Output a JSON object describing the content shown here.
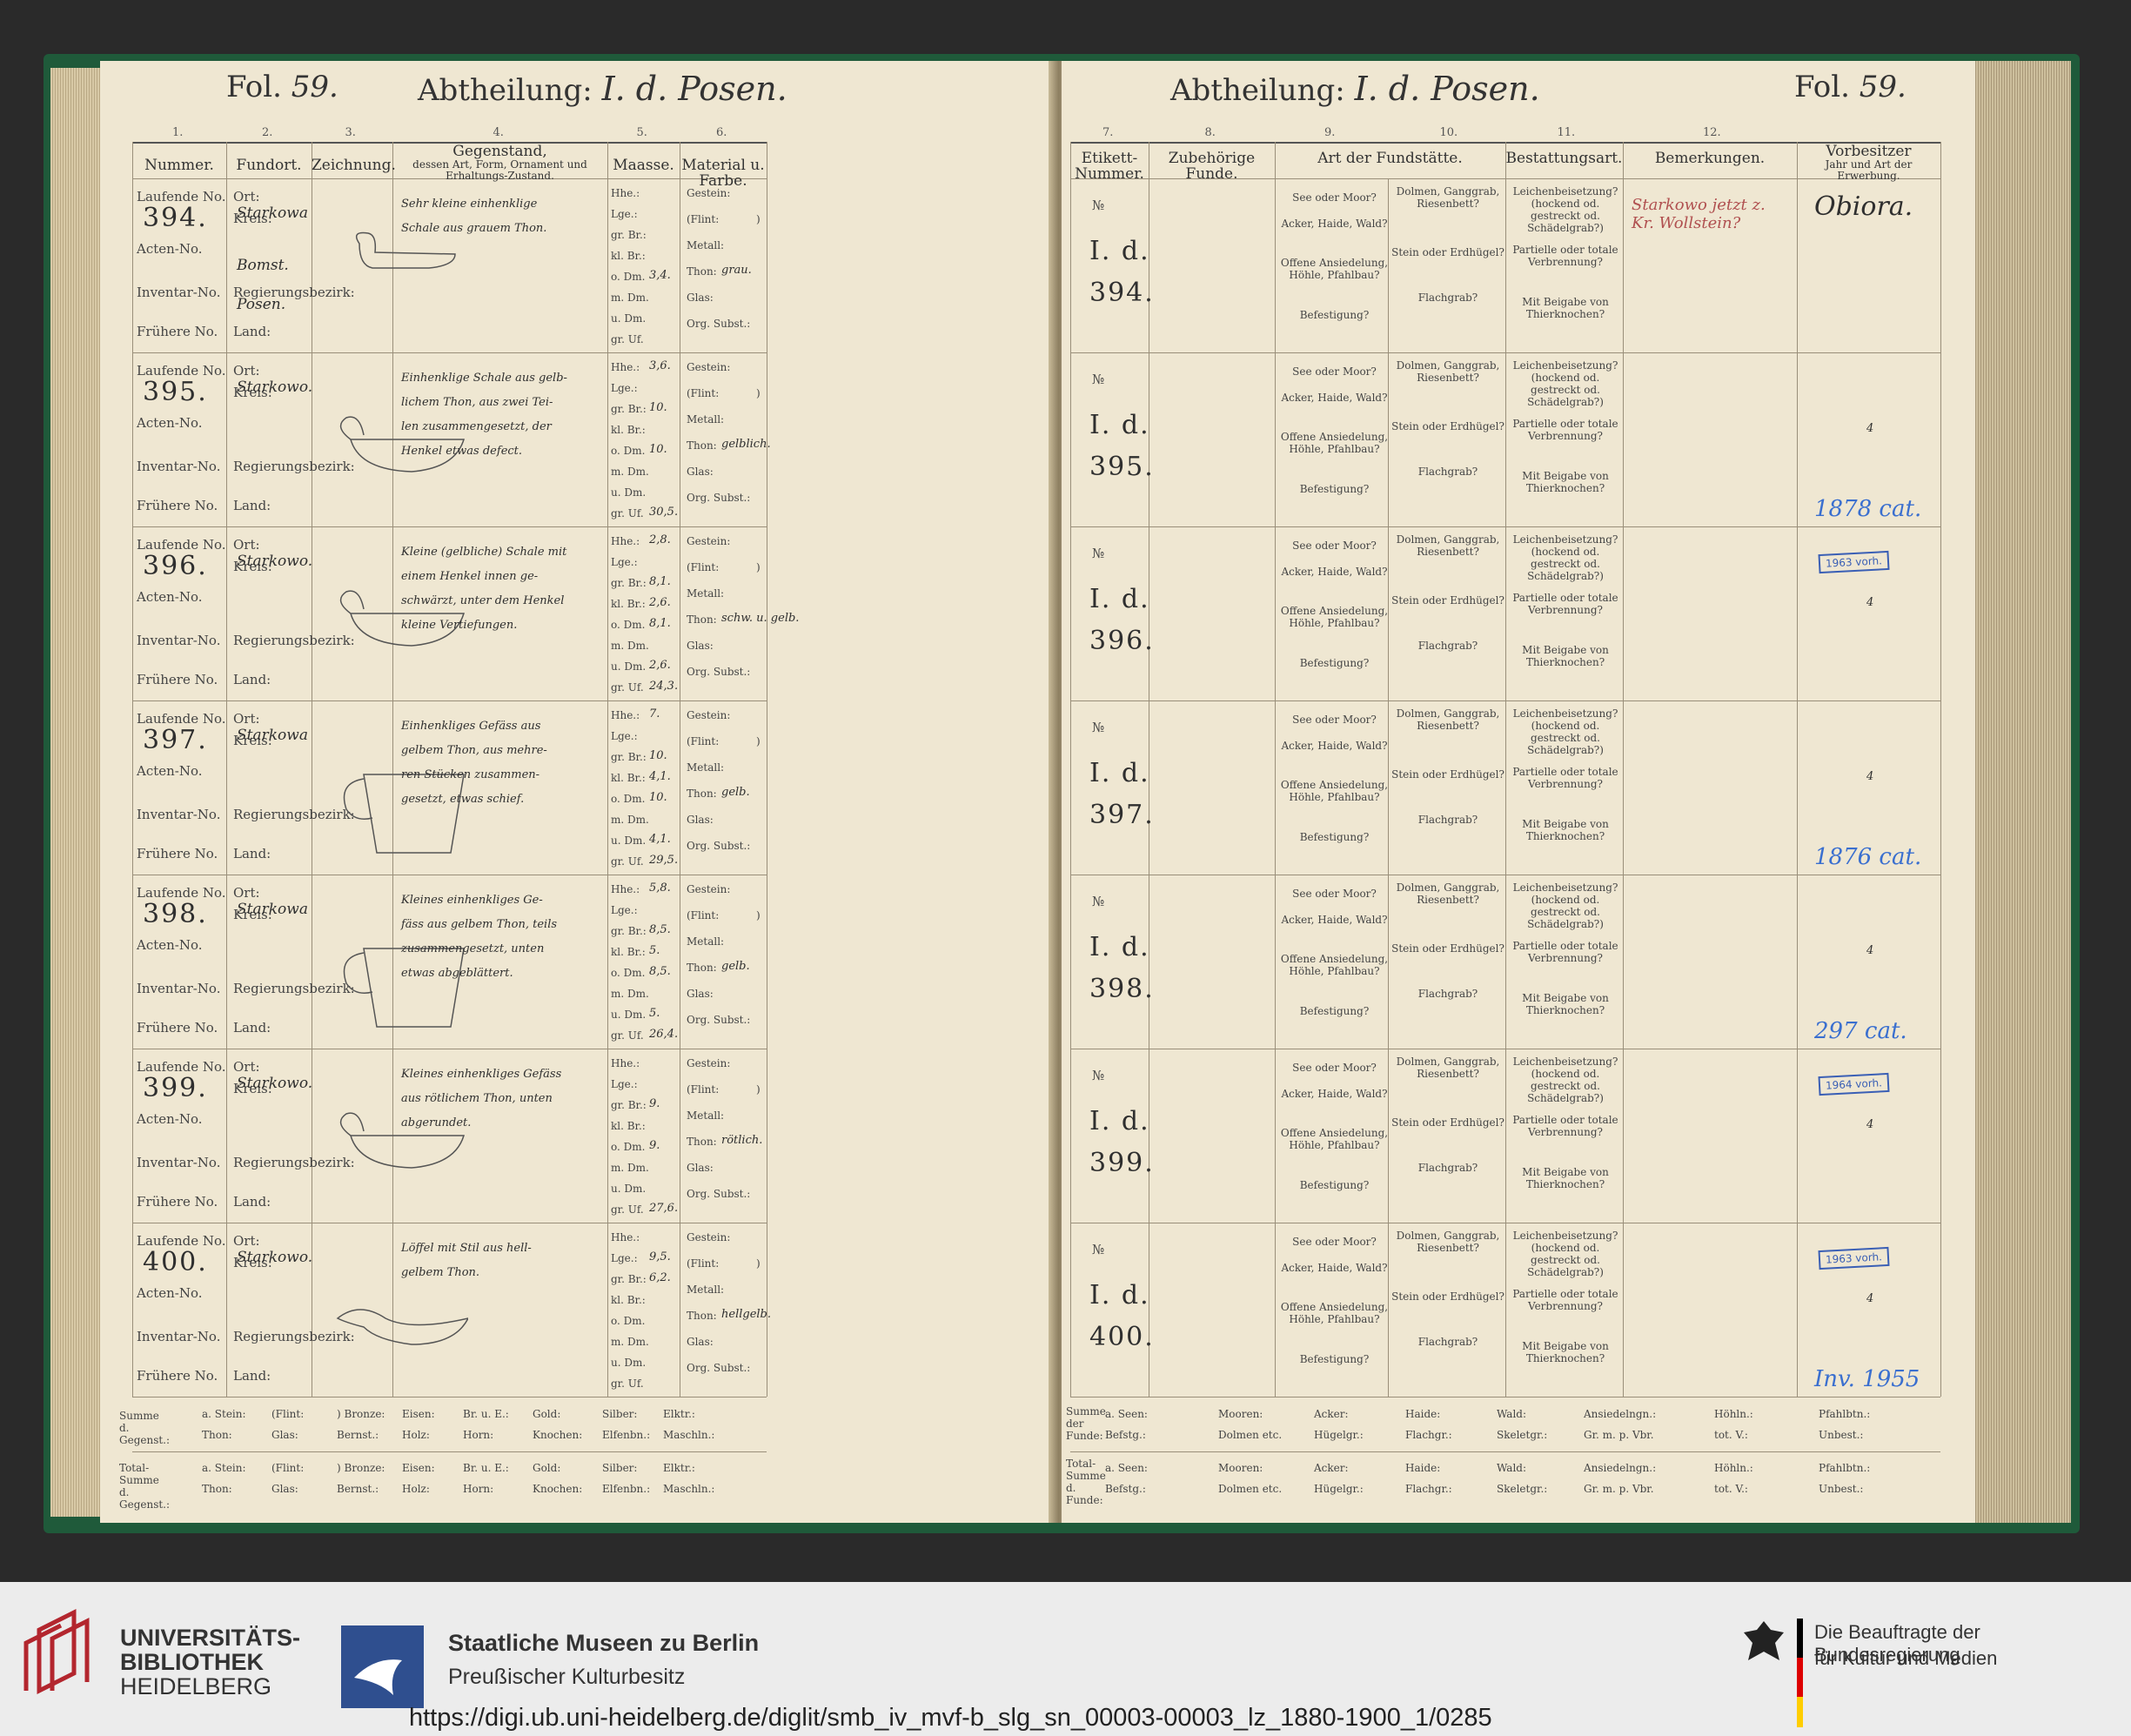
{
  "left": {
    "fol_label": "Fol.",
    "fol_no": "59.",
    "abt_label": "Abtheilung:",
    "abt_value": "I. d. Posen.",
    "colnums": [
      "1.",
      "2.",
      "3.",
      "4.",
      "5.",
      "6."
    ],
    "headers": {
      "nummer": "Nummer.",
      "fundort": "Fundort.",
      "zeichnung": "Zeichnung.",
      "gegenstand": "Gegenstand,",
      "gegenstand_sub": "dessen Art, Form, Ornament und Erhaltungs-Zustand.",
      "maasse": "Maasse.",
      "material": "Material u. Farbe."
    },
    "row_labels": [
      "Laufende No.",
      "Acten-No.",
      "Inventar-No.",
      "Frühere No."
    ],
    "fundort_labels": [
      "Ort:",
      "Kreis:",
      "Regierungsbezirk:",
      "Land:"
    ],
    "maasse_labels": [
      "Hhe.:",
      "Lge.:",
      "gr. Br.:",
      "kl. Br.:",
      "o. Dm.",
      "m. Dm.",
      "u. Dm.",
      "gr. Uf."
    ],
    "material_labels": [
      "Gestein:",
      "(Flint:",
      ")",
      "Metall:",
      "Thon:",
      "Glas:",
      "Org. Subst.:"
    ],
    "rows": [
      {
        "no": "394.",
        "ort": "Starkowa",
        "kreis": "Bomst.",
        "bezirk": "Posen.",
        "desc": [
          "Sehr kleine einhenklige",
          "Schale aus grauem Thon."
        ],
        "measures": [
          "",
          "",
          "",
          "",
          "3,4.",
          "",
          "",
          ""
        ],
        "thon": "grau."
      },
      {
        "no": "395.",
        "ort": "Starkowo.",
        "kreis": "",
        "bezirk": "",
        "desc": [
          "Einhenklige Schale aus gelb-",
          "lichem Thon, aus zwei Tei-",
          "len zusammengesetzt, der",
          "Henkel etwas defect."
        ],
        "measures": [
          "3,6.",
          "",
          "10.",
          "",
          "10.",
          "",
          "",
          "30,5."
        ],
        "thon": "gelblich."
      },
      {
        "no": "396.",
        "ort": "Starkowo.",
        "kreis": "",
        "bezirk": "",
        "desc": [
          "Kleine (gelbliche) Schale mit",
          "einem Henkel innen ge-",
          "schwärzt, unter dem Henkel",
          "kleine Vertiefungen."
        ],
        "measures": [
          "2,8.",
          "",
          "8,1.",
          "2,6.",
          "8,1.",
          "",
          "2,6.",
          "24,3."
        ],
        "thon": "schw. u. gelb."
      },
      {
        "no": "397.",
        "ort": "Starkowa",
        "kreis": "",
        "bezirk": "",
        "desc": [
          "Einhenkliges Gefäss aus",
          "gelbem Thon, aus mehre-",
          "ren Stücken zusammen-",
          "gesetzt, etwas schief."
        ],
        "measures": [
          "7.",
          "",
          "10.",
          "4,1.",
          "10.",
          "",
          "4,1.",
          "29,5."
        ],
        "thon": "gelb."
      },
      {
        "no": "398.",
        "ort": "Starkowa",
        "kreis": "",
        "bezirk": "",
        "desc": [
          "Kleines einhenkliges Ge-",
          "fäss aus gelbem Thon, teils",
          "zusammengesetzt, unten",
          "etwas abgeblättert."
        ],
        "measures": [
          "5,8.",
          "",
          "8,5.",
          "5.",
          "8,5.",
          "",
          "5.",
          "26,4."
        ],
        "thon": "gelb."
      },
      {
        "no": "399.",
        "ort": "Starkowo.",
        "kreis": "",
        "bezirk": "",
        "desc": [
          "Kleines einhenkliges Gefäss",
          "aus rötlichem Thon, unten",
          "abgerundet."
        ],
        "measures": [
          "",
          "",
          "9.",
          "",
          "9.",
          "",
          "",
          "27,6."
        ],
        "thon": "rötlich."
      },
      {
        "no": "400.",
        "ort": "Starkowo.",
        "kreis": "",
        "bezirk": "",
        "desc": [
          "Löffel mit Stil aus hell-",
          "gelbem Thon."
        ],
        "measures": [
          "",
          "9,5.",
          "6,2.",
          "",
          "",
          "",
          "",
          ""
        ],
        "thon": "hellgelb."
      }
    ],
    "sum1_label": "Summe d. Gegenst.:",
    "sum1_row1": [
      "a. Stein:",
      "(Flint:",
      ") Bronze:",
      "Eisen:",
      "Br. u. E.:",
      "Gold:",
      "Silber:",
      "Elktr.:"
    ],
    "sum1_row2": [
      "Thon:",
      "Glas:",
      "Bernst.:",
      "Holz:",
      "Horn:",
      "Knochen:",
      "Elfenbn.:",
      "Maschln.:"
    ],
    "sum2_label": "Total-Summe d. Gegenst.:",
    "sum2_row1": [
      "a. Stein:",
      "(Flint:",
      ") Bronze:",
      "Eisen:",
      "Br. u. E.:",
      "Gold:",
      "Silber:",
      "Elktr.:"
    ],
    "sum2_row2": [
      "Thon:",
      "Glas:",
      "Bernst.:",
      "Holz:",
      "Horn:",
      "Knochen:",
      "Elfenbn.:",
      "Maschln.:"
    ]
  },
  "right": {
    "fol_label": "Fol.",
    "fol_no": "59.",
    "abt_label": "Abtheilung:",
    "abt_value": "I. d. Posen.",
    "colnums": [
      "7.",
      "8.",
      "9.",
      "10.",
      "11.",
      "12."
    ],
    "headers": {
      "etikett": "Etikett-Nummer.",
      "zubehoerige": "Zubehörige Funde.",
      "art": "Art der Fundstätte.",
      "bestattung": "Bestattungsart.",
      "bemerkungen": "Bemerkungen.",
      "vorbesitzer": "Vorbesitzer",
      "vorbesitzer_sub": "Jahr und Art der Erwerbung."
    },
    "art_labels": [
      "See oder Moor?",
      "Acker, Haide, Wald?",
      "Offene Ansiedelung, Höhle, Pfahlbau?",
      "Befestigung?"
    ],
    "art_labels2": [
      "Dolmen, Ganggrab, Riesenbett?",
      "Stein oder Erdhügel?",
      "Flachgrab?"
    ],
    "best_labels": [
      "Leichenbeisetzung? (hockend od. gestreckt od. Schädelgrab?)",
      "Partielle oder totale Verbrennung?",
      "Mit Beigabe von Thierknochen?"
    ],
    "rows": [
      {
        "etikett": "I. d. 394.",
        "bem": "Starkowo jetzt z. Kr. Wollstein?",
        "vorb": "Obiora.",
        "note": ""
      },
      {
        "etikett": "I. d. 395.",
        "bem": "",
        "vorb": "4",
        "note": "1878 cat."
      },
      {
        "etikett": "I. d. 396.",
        "bem": "",
        "vorb": "4",
        "note": "",
        "stamp": "1963 vorh."
      },
      {
        "etikett": "I. d. 397.",
        "bem": "",
        "vorb": "4",
        "note": "1876 cat."
      },
      {
        "etikett": "I. d. 398.",
        "bem": "",
        "vorb": "4",
        "note": "297 cat."
      },
      {
        "etikett": "I. d. 399.",
        "bem": "",
        "vorb": "4",
        "note": "",
        "stamp": "1964 vorh."
      },
      {
        "etikett": "I. d. 400.",
        "bem": "",
        "vorb": "4",
        "note": "Inv. 1955",
        "stamp": "1963 vorh."
      }
    ],
    "n_mark": "№",
    "sum1_label": "Summe der Funde:",
    "sum1_row1": [
      "a. Seen:",
      "Mooren:",
      "Acker:",
      "Haide:",
      "Wald:",
      "Ansiedelngn.:",
      "Höhln.:",
      "Pfahlbtn.:"
    ],
    "sum1_row2": [
      "Befstg.:",
      "Dolmen etc.",
      "Hügelgr.:",
      "Flachgr.:",
      "Skeletgr.:",
      "Gr. m. p. Vbr.",
      "tot. V.:",
      "Unbest.:"
    ],
    "sum2_label": "Total-Summe d. Funde:",
    "sum2_row1": [
      "a. Seen:",
      "Mooren:",
      "Acker:",
      "Haide:",
      "Wald:",
      "Ansiedelngn.:",
      "Höhln.:",
      "Pfahlbtn.:"
    ],
    "sum2_row2": [
      "Befstg.:",
      "Dolmen etc.",
      "Hügelgr.:",
      "Flachgr.:",
      "Skeletgr.:",
      "Gr. m. p. Vbr.",
      "tot. V.:",
      "Unbest.:"
    ]
  },
  "footer": {
    "logo1_line1": "UNIVERSITÄTS-",
    "logo1_line2": "BIBLIOTHEK",
    "logo1_line3": "HEIDELBERG",
    "logo2_line1": "Staatliche Museen zu Berlin",
    "logo2_line2": "Preußischer Kulturbesitz",
    "logo3_line1": "Die Beauftragte der Bundesregierung",
    "logo3_line2": "für Kultur und Medien",
    "url": "https://digi.ub.uni-heidelberg.de/diglit/smb_iv_mvf-b_slg_sn_00003-00003_lz_1880-1900_1/0285"
  },
  "colors": {
    "paper": "#efe7d2",
    "cover": "#1f5a3a",
    "stamp_blue": "#3a5fb5",
    "footer": "#ececec",
    "heidelberg_red": "#b3262e",
    "smb_blue": "#2f4f8f"
  }
}
